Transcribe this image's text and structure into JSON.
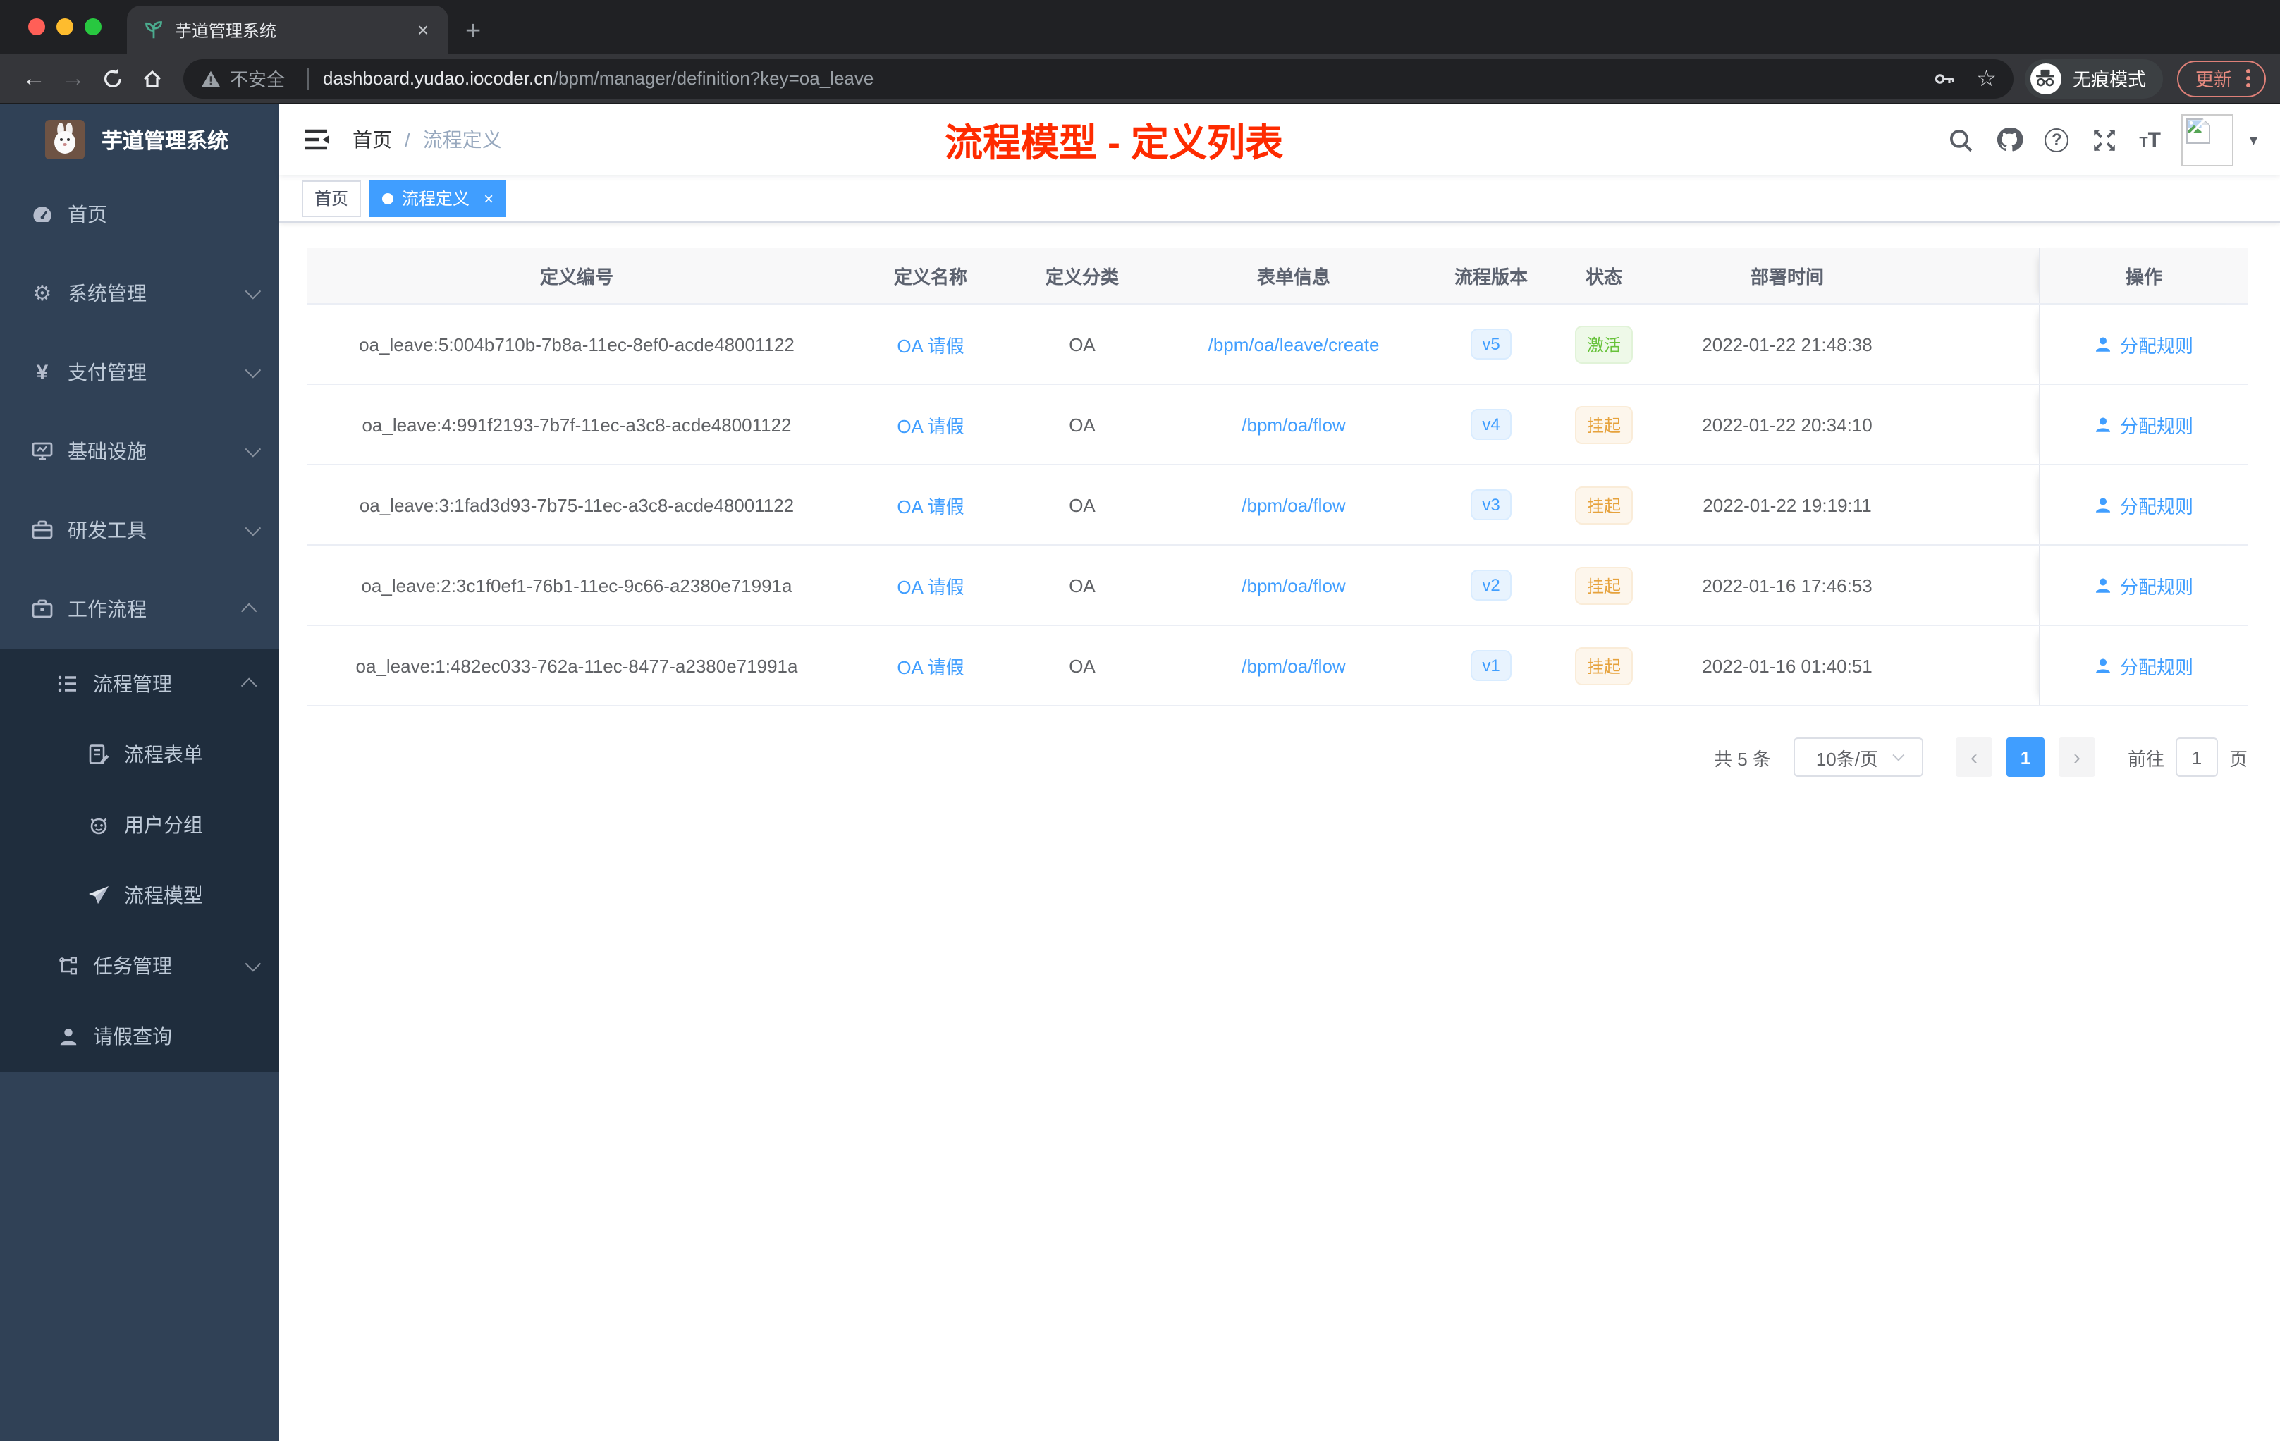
{
  "browser": {
    "tab_title": "芋道管理系统",
    "close_tab": "×",
    "new_tab": "+",
    "back": "←",
    "forward": "→",
    "not_secure": "不安全",
    "url_host": "dashboard.yudao.iocoder.cn",
    "url_path": "/bpm/manager/definition?key=oa_leave",
    "star": "☆",
    "incognito_label": "无痕模式",
    "update_label": "更新"
  },
  "sidebar": {
    "app_title": "芋道管理系统",
    "items": [
      {
        "label": "首页"
      },
      {
        "label": "系统管理"
      },
      {
        "label": "支付管理"
      },
      {
        "label": "基础设施"
      },
      {
        "label": "研发工具"
      },
      {
        "label": "工作流程"
      },
      {
        "label": "流程管理"
      },
      {
        "label": "流程表单"
      },
      {
        "label": "用户分组"
      },
      {
        "label": "流程模型"
      },
      {
        "label": "任务管理"
      },
      {
        "label": "请假查询"
      }
    ]
  },
  "navbar": {
    "breadcrumb_home": "首页",
    "breadcrumb_sep": "/",
    "breadcrumb_current": "流程定义",
    "annotation": "流程模型 - 定义列表",
    "caret": "▾"
  },
  "tags": {
    "home": "首页",
    "active": "流程定义",
    "close": "×"
  },
  "table": {
    "headers": [
      "定义编号",
      "定义名称",
      "定义分类",
      "表单信息",
      "流程版本",
      "状态",
      "部署时间",
      "操作"
    ],
    "rows": [
      {
        "id": "oa_leave:5:004b710b-7b8a-11ec-8ef0-acde48001122",
        "name": "OA 请假",
        "category": "OA",
        "form": "/bpm/oa/leave/create",
        "version": "v5",
        "status": "激活",
        "time": "2022-01-22 21:48:38",
        "action": "分配规则"
      },
      {
        "id": "oa_leave:4:991f2193-7b7f-11ec-a3c8-acde48001122",
        "name": "OA 请假",
        "category": "OA",
        "form": "/bpm/oa/flow",
        "version": "v4",
        "status": "挂起",
        "time": "2022-01-22 20:34:10",
        "action": "分配规则"
      },
      {
        "id": "oa_leave:3:1fad3d93-7b75-11ec-a3c8-acde48001122",
        "name": "OA 请假",
        "category": "OA",
        "form": "/bpm/oa/flow",
        "version": "v3",
        "status": "挂起",
        "time": "2022-01-22 19:19:11",
        "action": "分配规则"
      },
      {
        "id": "oa_leave:2:3c1f0ef1-76b1-11ec-9c66-a2380e71991a",
        "name": "OA 请假",
        "category": "OA",
        "form": "/bpm/oa/flow",
        "version": "v2",
        "status": "挂起",
        "time": "2022-01-16 17:46:53",
        "action": "分配规则"
      },
      {
        "id": "oa_leave:1:482ec033-762a-11ec-8477-a2380e71991a",
        "name": "OA 请假",
        "category": "OA",
        "form": "/bpm/oa/flow",
        "version": "v1",
        "status": "挂起",
        "time": "2022-01-16 01:40:51",
        "action": "分配规则"
      }
    ]
  },
  "pagination": {
    "total": "共 5 条",
    "page_size": "10条/页",
    "prev": "‹",
    "page": "1",
    "next": "›",
    "goto_label": "前往",
    "goto_value": "1",
    "unit": "页"
  },
  "colors": {
    "accent": "#409eff",
    "annotation_red": "#fe2b00",
    "status_active_green": "#67c23a",
    "status_suspended_yellow": "#e6a23c",
    "sidebar_bg": "#304156",
    "submenu_bg": "#1f2d3d",
    "chrome_dark": "#202124",
    "chrome_toolbar": "#35363a"
  }
}
